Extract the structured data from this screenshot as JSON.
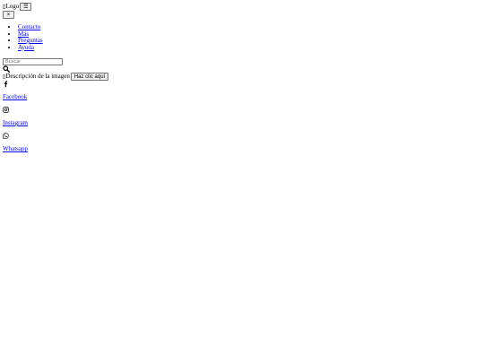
{
  "header": {
    "logo_alt": "Logo",
    "menu_toggle_label": "☰",
    "close_label": "×"
  },
  "nav": {
    "items": [
      {
        "label": "Contacto"
      },
      {
        "label": "Más"
      },
      {
        "label": "Preguntas"
      },
      {
        "label": "Ayuda"
      }
    ]
  },
  "search": {
    "placeholder": "Buscar",
    "icon": "search-icon"
  },
  "promo": {
    "image_alt": "Descripción de la imagen",
    "button_label": "Haz clic aquí"
  },
  "social": {
    "items": [
      {
        "label": "Facebook",
        "icon": "facebook-icon"
      },
      {
        "label": "Instagram",
        "icon": "instagram-icon"
      },
      {
        "label": "Whatsapp",
        "icon": "whatsapp-icon"
      }
    ]
  },
  "colors": {
    "link": "#0000ee",
    "button_bg": "#efefef",
    "button_border": "#767676",
    "text": "#000000",
    "background": "#ffffff"
  }
}
